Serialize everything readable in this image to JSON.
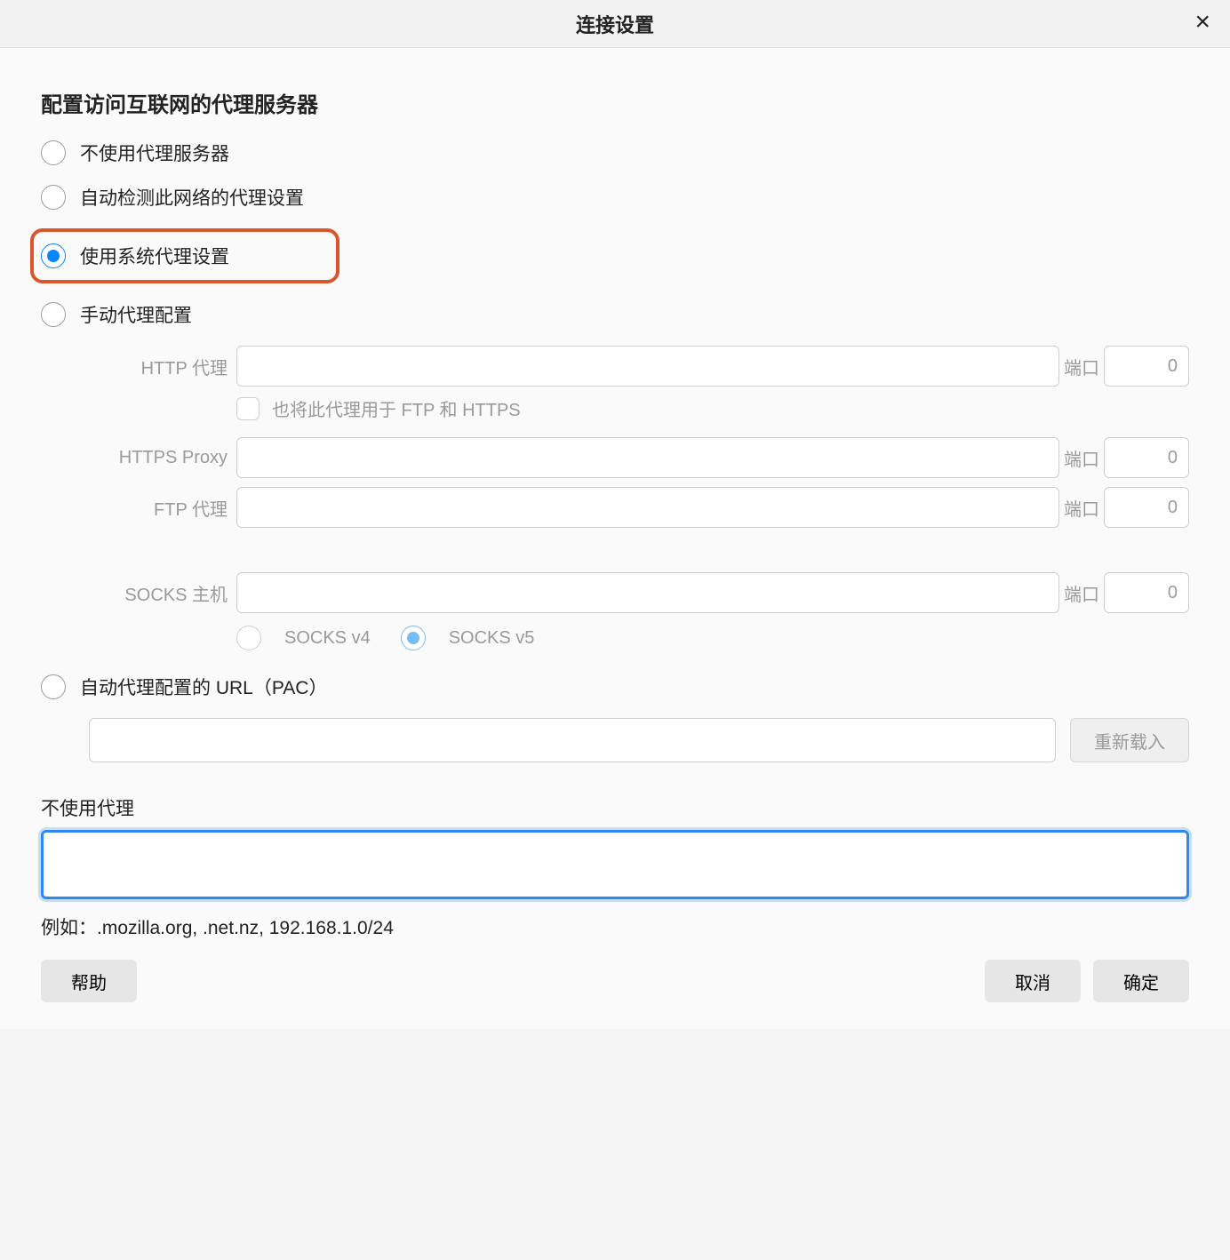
{
  "dialog": {
    "title": "连接设置",
    "section_title": "配置访问互联网的代理服务器"
  },
  "radios": {
    "no_proxy": "不使用代理服务器",
    "auto_detect": "自动检测此网络的代理设置",
    "system_proxy": "使用系统代理设置",
    "manual": "手动代理配置",
    "pac": "自动代理配置的 URL（PAC）"
  },
  "fields": {
    "http_label": "HTTP 代理",
    "https_label": "HTTPS Proxy",
    "ftp_label": "FTP 代理",
    "socks_label": "SOCKS 主机",
    "port_label": "端口",
    "port_value": "0",
    "use_for_all": "也将此代理用于 FTP 和 HTTPS",
    "socks_v4": "SOCKS v4",
    "socks_v5": "SOCKS v5",
    "reload": "重新载入"
  },
  "no_proxy_section": {
    "label": "不使用代理",
    "example": "例如：.mozilla.org, .net.nz, 192.168.1.0/24"
  },
  "buttons": {
    "help": "帮助",
    "cancel": "取消",
    "ok": "确定"
  }
}
